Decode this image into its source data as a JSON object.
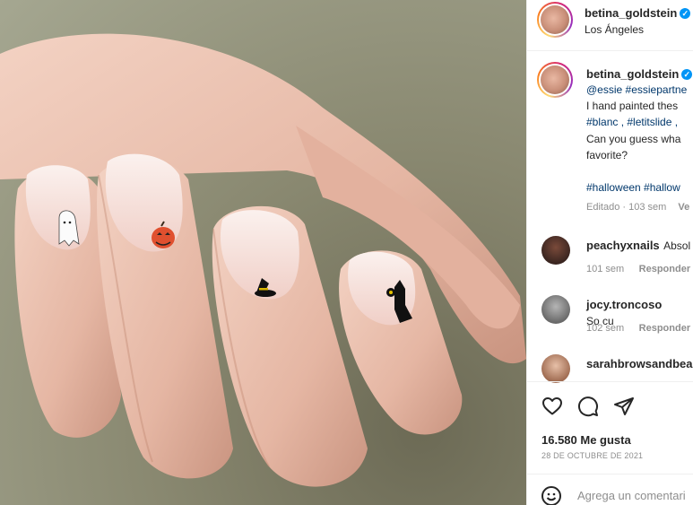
{
  "header": {
    "username": "betina_goldstein",
    "location": "Los Ángeles"
  },
  "caption": {
    "username": "betina_goldstein",
    "mentions": "@essie #essiepartne",
    "line1": "I hand painted thes",
    "tags_line": "#blanc , #letitslide ,",
    "line3": "Can you guess wha",
    "line4": "favorite?",
    "hashtags": "#halloween #hallow",
    "meta_edited": "Editado · 103 sem",
    "meta_more": "Ve"
  },
  "comments": [
    {
      "username": "peachyxnails",
      "text": "Absol",
      "time": "101 sem",
      "reply": "Responder"
    },
    {
      "username": "jocy.troncoso",
      "text": "So cu",
      "time": "102 sem",
      "reply": "Responder"
    },
    {
      "username": "sarahbrowsandbea",
      "text": "",
      "time": "",
      "reply": ""
    }
  ],
  "actions": {
    "likes": "16.580 Me gusta",
    "date": "28 DE OCTUBRE DE 2021"
  },
  "add_comment": {
    "placeholder": "Agrega un comentari"
  },
  "icons": {
    "like": "heart-icon",
    "comment": "comment-icon",
    "share": "share-icon",
    "emoji": "emoji-icon",
    "verified": "verified-badge-icon"
  },
  "colors": {
    "link": "#00376b",
    "verified": "#0095f6",
    "muted": "#8e8e8e"
  }
}
